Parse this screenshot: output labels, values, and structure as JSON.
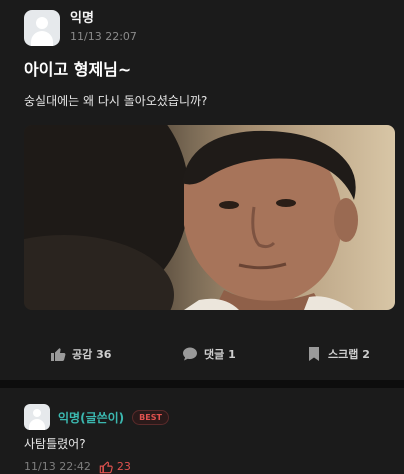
{
  "post": {
    "author": "익명",
    "time": "11/13 22:07",
    "title": "아이고 형제님~",
    "body": "숭실대에는 왜 다시 돌아오셨습니까?",
    "actions": {
      "like_label": "공감 36",
      "comment_label": "댓글 1",
      "scrap_label": "스크랩 2"
    }
  },
  "comment": {
    "author": "익명(글쓴이)",
    "badge": "BEST",
    "text": "사탐틀렸어?",
    "time": "11/13 22:42",
    "like_count": "23"
  },
  "colors": {
    "background": "#1b1b1b",
    "comment_author": "#3bb8b0",
    "best_badge": "#e0524f",
    "like_accent": "#e0524f"
  },
  "icons": [
    "avatar-icon",
    "thumbs-up-icon",
    "speech-bubble-icon",
    "bookmark-icon"
  ]
}
